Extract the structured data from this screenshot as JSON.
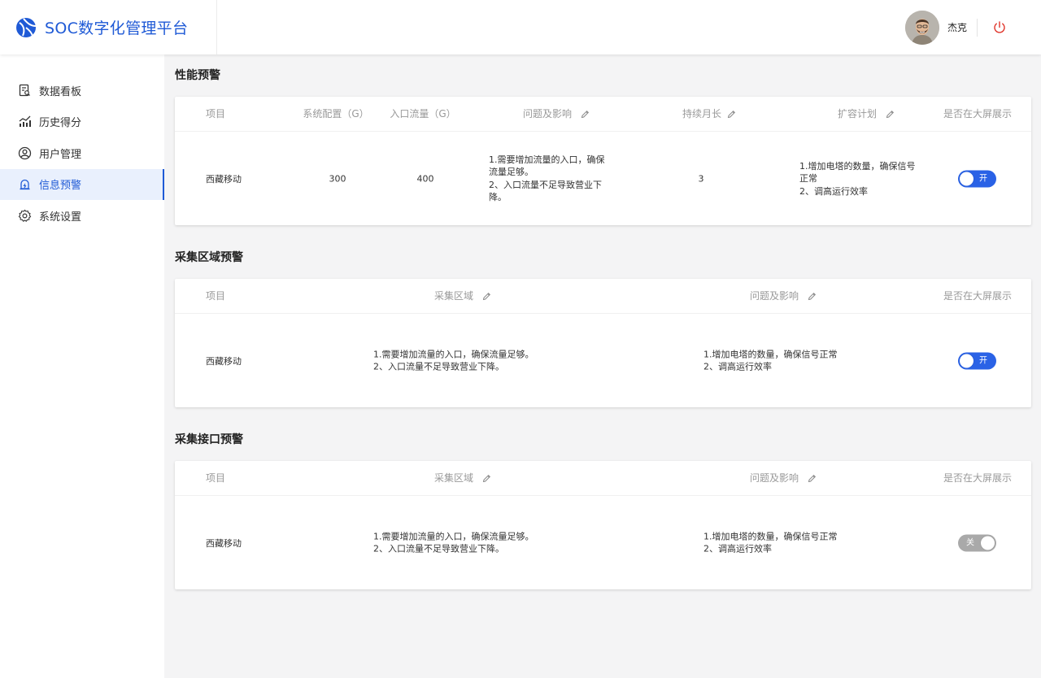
{
  "app": {
    "title": "SOC数字化管理平台"
  },
  "user": {
    "name": "杰克"
  },
  "colors": {
    "accent": "#1f5ad6",
    "switch_on": "#2a62e6",
    "switch_off": "#a9a9a9",
    "power": "#e0352b"
  },
  "sidebar": {
    "items": [
      {
        "label": "数据看板",
        "icon": "dashboard-icon",
        "active": false
      },
      {
        "label": "历史得分",
        "icon": "chart-icon",
        "active": false
      },
      {
        "label": "用户管理",
        "icon": "user-icon",
        "active": false
      },
      {
        "label": "信息预警",
        "icon": "alert-icon",
        "active": true
      },
      {
        "label": "系统设置",
        "icon": "gear-icon",
        "active": false
      }
    ]
  },
  "sections": {
    "performance": {
      "title": "性能预警",
      "headers": {
        "item": "项目",
        "config": "系统配置（G）",
        "traffic": "入口流量（G）",
        "issue": "问题及影响",
        "duration": "持续月长",
        "plan": "扩容计划",
        "display": "是否在大屏展示"
      },
      "row": {
        "item": "西藏移动",
        "config": "300",
        "traffic": "400",
        "issue": "1.需要增加流量的入口，确保\n流量足够。\n2、入口流量不足导致营业下\n降。",
        "duration": "3",
        "plan": "1.增加电塔的数量，确保信号\n正常\n2、调高运行效率",
        "display_label": "开",
        "display_on": true
      }
    },
    "region": {
      "title": "采集区域预警",
      "headers": {
        "item": "项目",
        "region": "采集区域",
        "issue": "问题及影响",
        "display": "是否在大屏展示"
      },
      "row": {
        "item": "西藏移动",
        "region": "1.需要增加流量的入口，确保流量足够。\n2、入口流量不足导致营业下降。",
        "issue": "1.增加电塔的数量，确保信号正常\n2、调高运行效率",
        "display_label": "开",
        "display_on": true
      }
    },
    "interface": {
      "title": "采集接口预警",
      "headers": {
        "item": "项目",
        "region": "采集区域",
        "issue": "问题及影响",
        "display": "是否在大屏展示"
      },
      "row": {
        "item": "西藏移动",
        "region": "1.需要增加流量的入口，确保流量足够。\n2、入口流量不足导致营业下降。",
        "issue": "1.增加电塔的数量，确保信号正常\n2、调高运行效率",
        "display_label": "关",
        "display_on": false
      }
    }
  }
}
